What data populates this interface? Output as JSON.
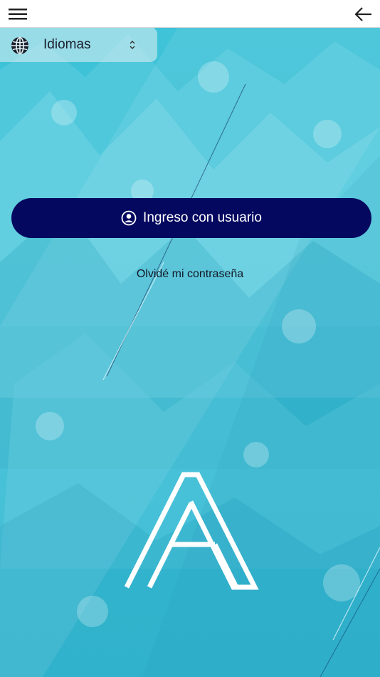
{
  "header": {
    "menu_icon": "hamburger-menu-icon",
    "back_icon": "arrow-left-icon"
  },
  "language": {
    "icon": "globe-icon",
    "label": "Idiomas",
    "chevron_icon": "chevron-up-down-icon"
  },
  "login": {
    "icon": "user-circle-icon",
    "label": "Ingreso con usuario"
  },
  "forgot_password": {
    "label": "Olvidé mi contraseña"
  },
  "logo": {
    "icon": "brand-a-logo"
  },
  "colors": {
    "background": "#3cbfd6",
    "primary_button": "#05085f",
    "topbar": "#ffffff",
    "text_dark": "#111827",
    "logo": "#ffffff"
  }
}
